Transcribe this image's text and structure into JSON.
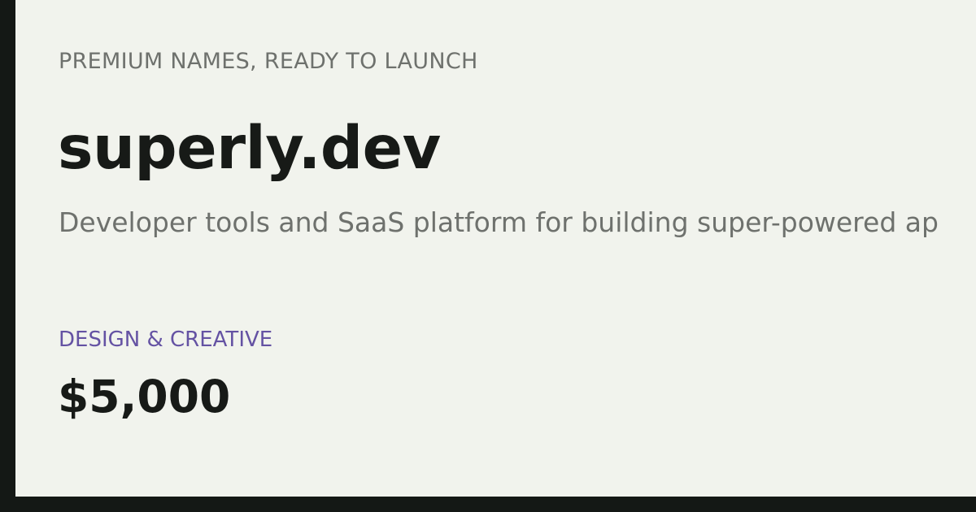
{
  "listing": {
    "tagline": "PREMIUM NAMES, READY TO LAUNCH",
    "domain_name": "superly.dev",
    "description": "Developer tools and SaaS platform for building super-powered ap",
    "category": "DESIGN & CREATIVE",
    "price": "$5,000"
  },
  "colors": {
    "background": "#141815",
    "card": "#f1f3ed",
    "heading": "#171a17",
    "muted_text": "#6e716d",
    "category_accent": "#6452a3"
  }
}
